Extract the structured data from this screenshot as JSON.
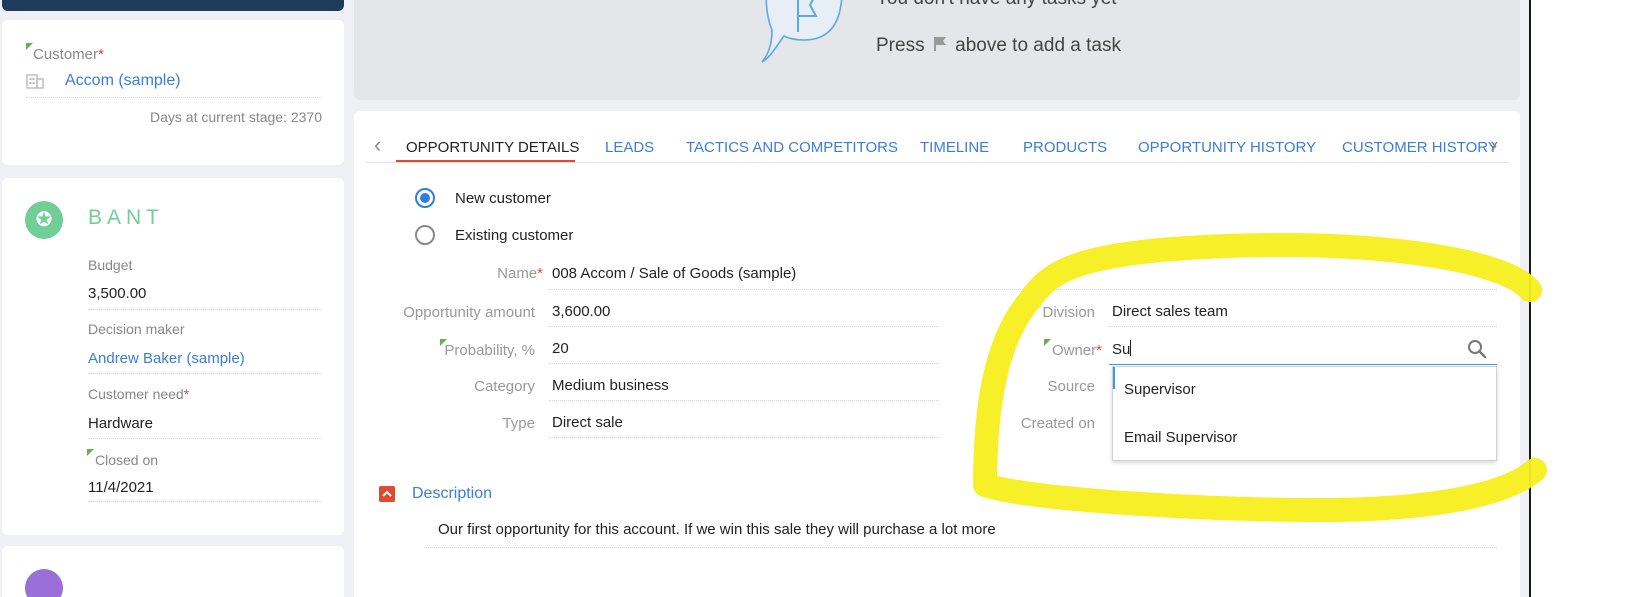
{
  "tasks": {
    "empty_title": "You don't have any tasks yet",
    "hint_before": "Press",
    "hint_after": "above to add a task"
  },
  "customer_card": {
    "label": "Customer",
    "value": "Accom (sample)",
    "days_label": "Days at current stage:",
    "days_value": "2370"
  },
  "bant": {
    "title": "BANT",
    "budget_label": "Budget",
    "budget_value": "3,500.00",
    "decision_maker_label": "Decision maker",
    "decision_maker_value": "Andrew Baker (sample)",
    "need_label": "Customer need",
    "need_value": "Hardware",
    "closed_label": "Closed on",
    "closed_value": "11/4/2021"
  },
  "tabs": [
    {
      "label": "OPPORTUNITY DETAILS"
    },
    {
      "label": "LEADS"
    },
    {
      "label": "TACTICS AND COMPETITORS"
    },
    {
      "label": "TIMELINE"
    },
    {
      "label": "PRODUCTS"
    },
    {
      "label": "OPPORTUNITY HISTORY"
    },
    {
      "label": "CUSTOMER HISTORY"
    }
  ],
  "customer_type": {
    "options": [
      "New customer",
      "Existing customer"
    ],
    "selected": "New customer"
  },
  "fields": {
    "name_label": "Name",
    "name_value": "008 Accom / Sale of Goods (sample)",
    "amount_label": "Opportunity amount",
    "amount_value": "3,600.00",
    "probability_label": "Probability, %",
    "probability_value": "20",
    "category_label": "Category",
    "category_value": "Medium business",
    "type_label": "Type",
    "type_value": "Direct sale",
    "division_label": "Division",
    "division_value": "Direct sales team",
    "owner_label": "Owner",
    "owner_value": "Su",
    "source_label": "Source",
    "created_label": "Created on"
  },
  "owner_dropdown": [
    "Supervisor",
    "Email Supervisor"
  ],
  "description": {
    "title": "Description",
    "text": "Our first opportunity for this account. If we win this sale they will purchase a lot more"
  },
  "colors": {
    "accent": "#3b7dd8",
    "active_tab_underline": "#e04a2f",
    "required": "#e04a2f",
    "bant_green": "#6fcf97",
    "highlight": "#f7ee1b"
  },
  "icons": {
    "tasks": "flag-speech-bubble-icon",
    "customer": "building-icon",
    "bant": "star-badge-icon",
    "search": "search-icon"
  }
}
